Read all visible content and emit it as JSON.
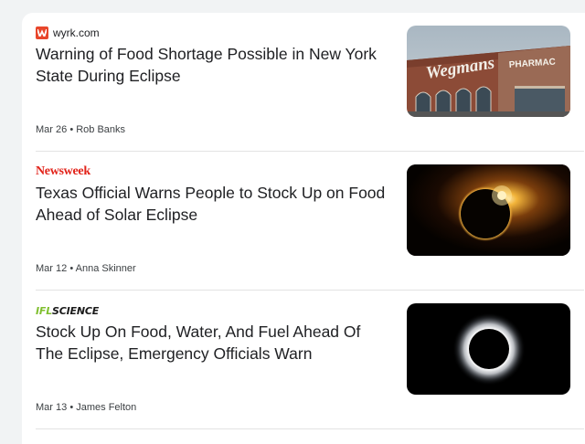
{
  "articles": [
    {
      "source": "wyrk.com",
      "logo_icon": "wyrk-logo-icon",
      "headline": "Warning of Food Shortage Possible in New York State During Eclipse",
      "date": "Mar 26",
      "author": "Rob Banks",
      "image_sign_text": "Wegmans",
      "image_sign_text_2": "PHARMAC"
    },
    {
      "source": "Newsweek",
      "headline": "Texas Official Warns People to Stock Up on Food Ahead of Solar Eclipse",
      "date": "Mar 12",
      "author": "Anna Skinner"
    },
    {
      "source_prefix": "IFL",
      "source_suffix": "SCIENCE",
      "headline": "Stock Up On Food, Water, And Fuel Ahead Of The Eclipse, Emergency Officials Warn",
      "date": "Mar 13",
      "author": "James Felton"
    }
  ],
  "colors": {
    "wyrk_brand": "#e8462b",
    "newsweek_brand": "#e2231a",
    "ifl_brand": "#7fbf2e"
  }
}
